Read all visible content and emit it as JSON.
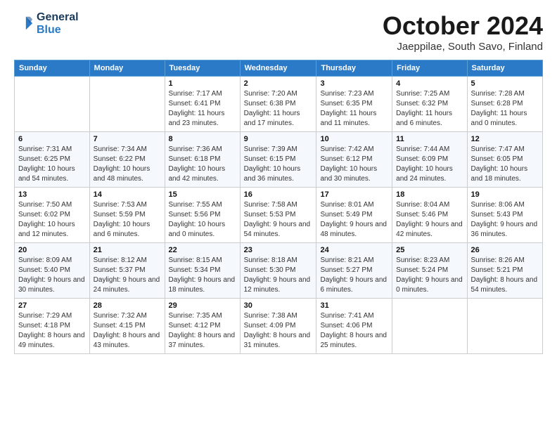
{
  "logo": {
    "line1": "General",
    "line2": "Blue"
  },
  "title": "October 2024",
  "location": "Jaeppilae, South Savo, Finland",
  "weekdays": [
    "Sunday",
    "Monday",
    "Tuesday",
    "Wednesday",
    "Thursday",
    "Friday",
    "Saturday"
  ],
  "weeks": [
    [
      {
        "day": "",
        "sunrise": "",
        "sunset": "",
        "daylight": ""
      },
      {
        "day": "",
        "sunrise": "",
        "sunset": "",
        "daylight": ""
      },
      {
        "day": "1",
        "sunrise": "Sunrise: 7:17 AM",
        "sunset": "Sunset: 6:41 PM",
        "daylight": "Daylight: 11 hours and 23 minutes."
      },
      {
        "day": "2",
        "sunrise": "Sunrise: 7:20 AM",
        "sunset": "Sunset: 6:38 PM",
        "daylight": "Daylight: 11 hours and 17 minutes."
      },
      {
        "day": "3",
        "sunrise": "Sunrise: 7:23 AM",
        "sunset": "Sunset: 6:35 PM",
        "daylight": "Daylight: 11 hours and 11 minutes."
      },
      {
        "day": "4",
        "sunrise": "Sunrise: 7:25 AM",
        "sunset": "Sunset: 6:32 PM",
        "daylight": "Daylight: 11 hours and 6 minutes."
      },
      {
        "day": "5",
        "sunrise": "Sunrise: 7:28 AM",
        "sunset": "Sunset: 6:28 PM",
        "daylight": "Daylight: 11 hours and 0 minutes."
      }
    ],
    [
      {
        "day": "6",
        "sunrise": "Sunrise: 7:31 AM",
        "sunset": "Sunset: 6:25 PM",
        "daylight": "Daylight: 10 hours and 54 minutes."
      },
      {
        "day": "7",
        "sunrise": "Sunrise: 7:34 AM",
        "sunset": "Sunset: 6:22 PM",
        "daylight": "Daylight: 10 hours and 48 minutes."
      },
      {
        "day": "8",
        "sunrise": "Sunrise: 7:36 AM",
        "sunset": "Sunset: 6:18 PM",
        "daylight": "Daylight: 10 hours and 42 minutes."
      },
      {
        "day": "9",
        "sunrise": "Sunrise: 7:39 AM",
        "sunset": "Sunset: 6:15 PM",
        "daylight": "Daylight: 10 hours and 36 minutes."
      },
      {
        "day": "10",
        "sunrise": "Sunrise: 7:42 AM",
        "sunset": "Sunset: 6:12 PM",
        "daylight": "Daylight: 10 hours and 30 minutes."
      },
      {
        "day": "11",
        "sunrise": "Sunrise: 7:44 AM",
        "sunset": "Sunset: 6:09 PM",
        "daylight": "Daylight: 10 hours and 24 minutes."
      },
      {
        "day": "12",
        "sunrise": "Sunrise: 7:47 AM",
        "sunset": "Sunset: 6:05 PM",
        "daylight": "Daylight: 10 hours and 18 minutes."
      }
    ],
    [
      {
        "day": "13",
        "sunrise": "Sunrise: 7:50 AM",
        "sunset": "Sunset: 6:02 PM",
        "daylight": "Daylight: 10 hours and 12 minutes."
      },
      {
        "day": "14",
        "sunrise": "Sunrise: 7:53 AM",
        "sunset": "Sunset: 5:59 PM",
        "daylight": "Daylight: 10 hours and 6 minutes."
      },
      {
        "day": "15",
        "sunrise": "Sunrise: 7:55 AM",
        "sunset": "Sunset: 5:56 PM",
        "daylight": "Daylight: 10 hours and 0 minutes."
      },
      {
        "day": "16",
        "sunrise": "Sunrise: 7:58 AM",
        "sunset": "Sunset: 5:53 PM",
        "daylight": "Daylight: 9 hours and 54 minutes."
      },
      {
        "day": "17",
        "sunrise": "Sunrise: 8:01 AM",
        "sunset": "Sunset: 5:49 PM",
        "daylight": "Daylight: 9 hours and 48 minutes."
      },
      {
        "day": "18",
        "sunrise": "Sunrise: 8:04 AM",
        "sunset": "Sunset: 5:46 PM",
        "daylight": "Daylight: 9 hours and 42 minutes."
      },
      {
        "day": "19",
        "sunrise": "Sunrise: 8:06 AM",
        "sunset": "Sunset: 5:43 PM",
        "daylight": "Daylight: 9 hours and 36 minutes."
      }
    ],
    [
      {
        "day": "20",
        "sunrise": "Sunrise: 8:09 AM",
        "sunset": "Sunset: 5:40 PM",
        "daylight": "Daylight: 9 hours and 30 minutes."
      },
      {
        "day": "21",
        "sunrise": "Sunrise: 8:12 AM",
        "sunset": "Sunset: 5:37 PM",
        "daylight": "Daylight: 9 hours and 24 minutes."
      },
      {
        "day": "22",
        "sunrise": "Sunrise: 8:15 AM",
        "sunset": "Sunset: 5:34 PM",
        "daylight": "Daylight: 9 hours and 18 minutes."
      },
      {
        "day": "23",
        "sunrise": "Sunrise: 8:18 AM",
        "sunset": "Sunset: 5:30 PM",
        "daylight": "Daylight: 9 hours and 12 minutes."
      },
      {
        "day": "24",
        "sunrise": "Sunrise: 8:21 AM",
        "sunset": "Sunset: 5:27 PM",
        "daylight": "Daylight: 9 hours and 6 minutes."
      },
      {
        "day": "25",
        "sunrise": "Sunrise: 8:23 AM",
        "sunset": "Sunset: 5:24 PM",
        "daylight": "Daylight: 9 hours and 0 minutes."
      },
      {
        "day": "26",
        "sunrise": "Sunrise: 8:26 AM",
        "sunset": "Sunset: 5:21 PM",
        "daylight": "Daylight: 8 hours and 54 minutes."
      }
    ],
    [
      {
        "day": "27",
        "sunrise": "Sunrise: 7:29 AM",
        "sunset": "Sunset: 4:18 PM",
        "daylight": "Daylight: 8 hours and 49 minutes."
      },
      {
        "day": "28",
        "sunrise": "Sunrise: 7:32 AM",
        "sunset": "Sunset: 4:15 PM",
        "daylight": "Daylight: 8 hours and 43 minutes."
      },
      {
        "day": "29",
        "sunrise": "Sunrise: 7:35 AM",
        "sunset": "Sunset: 4:12 PM",
        "daylight": "Daylight: 8 hours and 37 minutes."
      },
      {
        "day": "30",
        "sunrise": "Sunrise: 7:38 AM",
        "sunset": "Sunset: 4:09 PM",
        "daylight": "Daylight: 8 hours and 31 minutes."
      },
      {
        "day": "31",
        "sunrise": "Sunrise: 7:41 AM",
        "sunset": "Sunset: 4:06 PM",
        "daylight": "Daylight: 8 hours and 25 minutes."
      },
      {
        "day": "",
        "sunrise": "",
        "sunset": "",
        "daylight": ""
      },
      {
        "day": "",
        "sunrise": "",
        "sunset": "",
        "daylight": ""
      }
    ]
  ]
}
